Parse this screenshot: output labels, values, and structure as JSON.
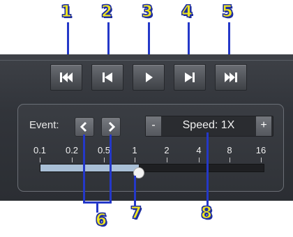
{
  "callouts": [
    "1",
    "2",
    "3",
    "4",
    "5",
    "6",
    "7",
    "8"
  ],
  "toolbar": {
    "buttons": [
      {
        "icon": "skip-to-start-icon"
      },
      {
        "icon": "step-back-icon"
      },
      {
        "icon": "play-icon"
      },
      {
        "icon": "step-forward-icon"
      },
      {
        "icon": "skip-to-end-icon"
      }
    ]
  },
  "event": {
    "label": "Event:",
    "prev_icon": "chevron-left-icon",
    "next_icon": "chevron-right-icon"
  },
  "speed": {
    "minus": "-",
    "text": "Speed: 1X",
    "plus": "+"
  },
  "scale": {
    "ticks": [
      "0.1",
      "0.2",
      "0.5",
      "1",
      "2",
      "4",
      "8",
      "16"
    ],
    "value": "1",
    "fill_fraction": 0.44
  },
  "colors": {
    "callout_fill": "#f0e61f",
    "callout_line": "#2438c8",
    "panel": "#33363b",
    "track_fill": "#a9bfd6",
    "track_empty": "#1e1f22"
  }
}
